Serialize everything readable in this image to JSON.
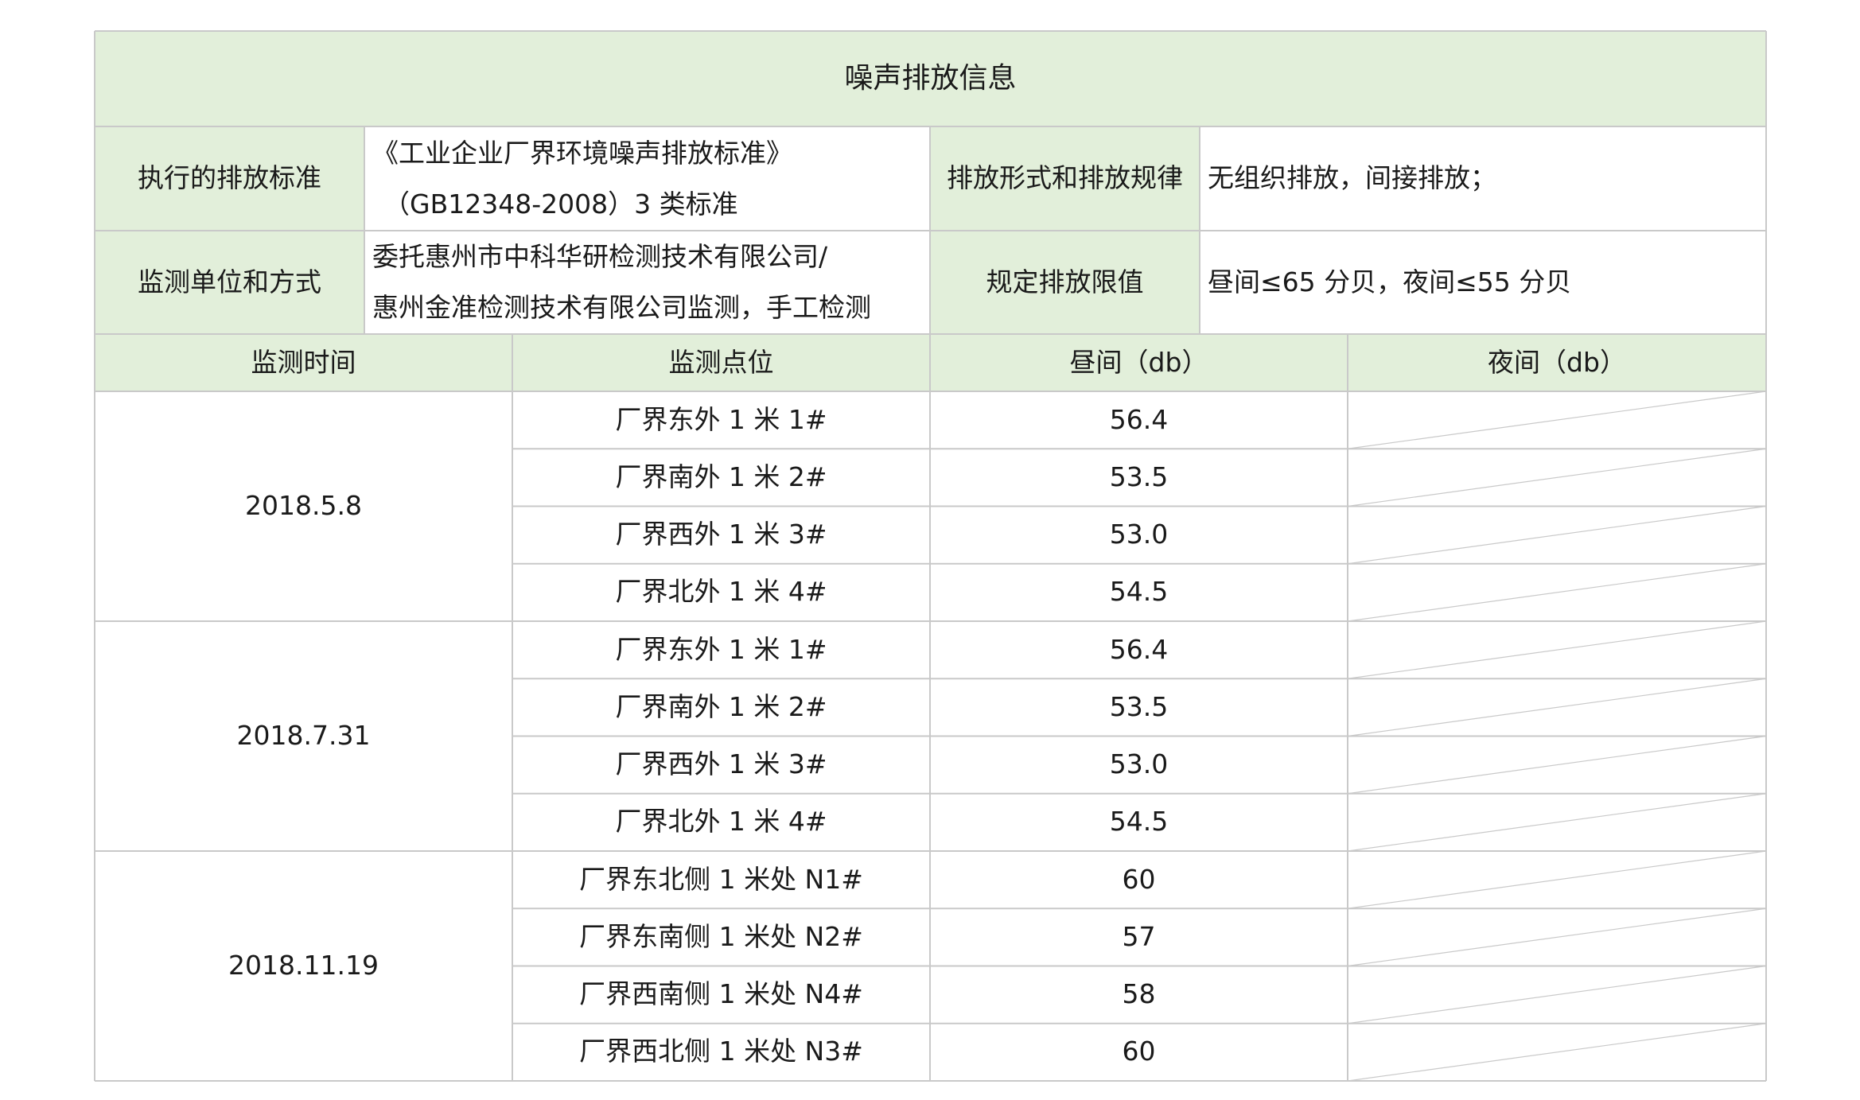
{
  "title": "噪声排放信息",
  "colors": {
    "header_bg": "#e2efda",
    "border": "#c9c9c9",
    "text": "#1a1a1a"
  },
  "info": {
    "std_label": "执行的排放标准",
    "std_line1": "《工业企业厂界环境噪声排放标准》",
    "std_line2": "（GB12348-2008）3 类标准",
    "mode_label": "排放形式和排放规律",
    "mode_value": "无组织排放，间接排放；",
    "unit_label": "监测单位和方式",
    "unit_line1": "委托惠州市中科华研检测技术有限公司/",
    "unit_line2": "惠州金准检测技术有限公司监测，手工检测",
    "limit_label": "规定排放限值",
    "limit_value": "昼间≤65 分贝，夜间≤55 分贝"
  },
  "columns": [
    "监测时间",
    "监测点位",
    "昼间（db）",
    "夜间（db）"
  ],
  "groups": [
    {
      "date": "2018.5.8",
      "rows": [
        {
          "point": "厂界东外 1 米 1#",
          "day": "56.4",
          "night": ""
        },
        {
          "point": "厂界南外 1 米 2#",
          "day": "53.5",
          "night": ""
        },
        {
          "point": "厂界西外 1 米 3#",
          "day": "53.0",
          "night": ""
        },
        {
          "point": "厂界北外 1 米 4#",
          "day": "54.5",
          "night": ""
        }
      ]
    },
    {
      "date": "2018.7.31",
      "rows": [
        {
          "point": "厂界东外 1 米 1#",
          "day": "56.4",
          "night": ""
        },
        {
          "point": "厂界南外 1 米 2#",
          "day": "53.5",
          "night": ""
        },
        {
          "point": "厂界西外 1 米 3#",
          "day": "53.0",
          "night": ""
        },
        {
          "point": "厂界北外 1 米 4#",
          "day": "54.5",
          "night": ""
        }
      ]
    },
    {
      "date": "2018.11.19",
      "rows": [
        {
          "point": "厂界东北侧 1 米处 N1#",
          "day": "60",
          "night": ""
        },
        {
          "point": "厂界东南侧 1 米处 N2#",
          "day": "57",
          "night": ""
        },
        {
          "point": "厂界西南侧 1 米处 N4#",
          "day": "58",
          "night": ""
        },
        {
          "point": "厂界西北侧 1 米处 N3#",
          "day": "60",
          "night": ""
        }
      ]
    }
  ]
}
